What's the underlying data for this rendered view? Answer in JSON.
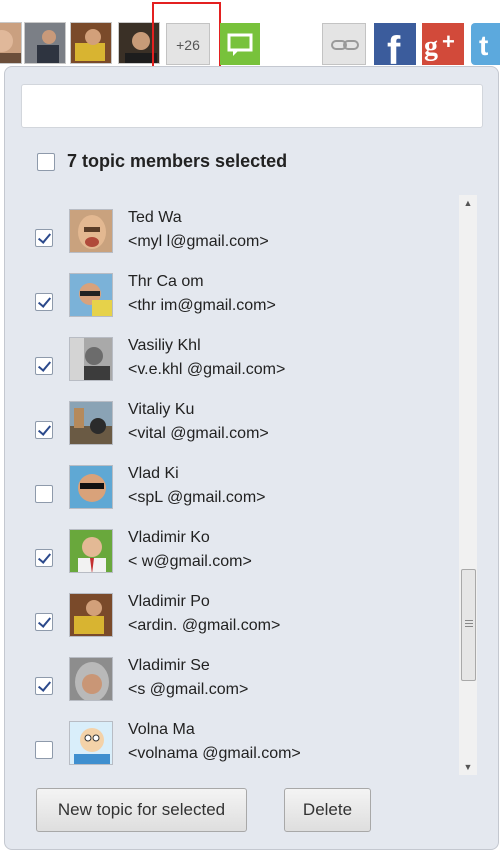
{
  "toolbar": {
    "more_label": "+26",
    "icons": [
      "chat-icon",
      "link-icon",
      "facebook-icon",
      "google-plus-icon",
      "twitter-icon"
    ],
    "accent_red": "#e32020",
    "facebook_color": "#3b5c9c",
    "google_color": "#d24a3a",
    "twitter_color": "#5ca9dd",
    "chat_color": "#78c23b"
  },
  "panel": {
    "search": {
      "value": "",
      "placeholder": ""
    },
    "select_all": {
      "checked": false,
      "label": "7 topic members selected"
    },
    "members": [
      {
        "name": "Ted Wa",
        "email": "<myl        l@gmail.com>",
        "checked": true
      },
      {
        "name": "Thr     Ca    om",
        "email": "<thr       im@gmail.com>",
        "checked": true
      },
      {
        "name": "Vasiliy Khl",
        "email": "<v.e.khl       @gmail.com>",
        "checked": true
      },
      {
        "name": "Vitaliy Ku",
        "email": "<vital     @gmail.com>",
        "checked": true
      },
      {
        "name": "Vlad Ki",
        "email": "<spL     @gmail.com>",
        "checked": false
      },
      {
        "name": "Vladimir Ko",
        "email": "<       w@gmail.com>",
        "checked": true
      },
      {
        "name": "Vladimir Po",
        "email": "<ardin.     @gmail.com>",
        "checked": true
      },
      {
        "name": "Vladimir Se",
        "email": "<s       @gmail.com>",
        "checked": true
      },
      {
        "name": "Volna Ma",
        "email": "<volnama    @gmail.com>",
        "checked": false
      }
    ],
    "buttons": {
      "new_topic": "New topic for selected",
      "delete": "Delete"
    }
  }
}
